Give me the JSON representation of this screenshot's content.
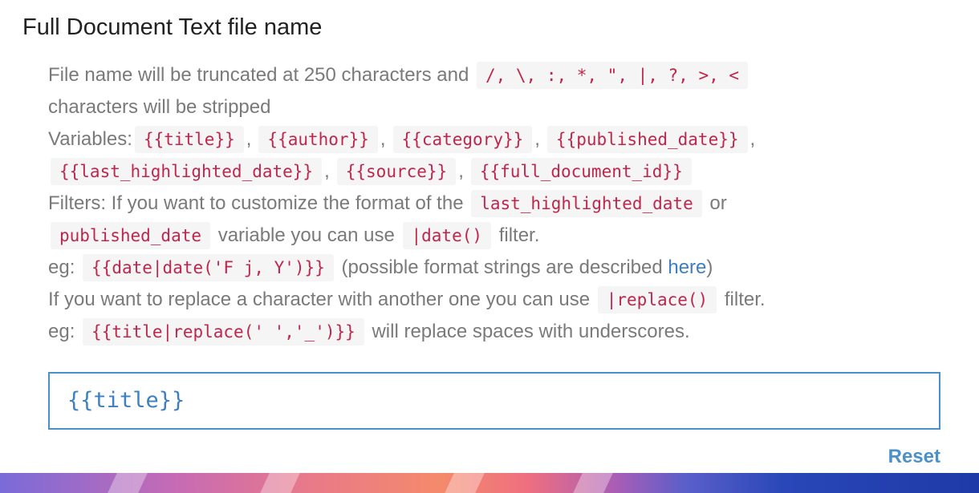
{
  "section": {
    "title": "Full Document Text file name"
  },
  "help": {
    "line1_text": "File name will be truncated at 250 characters and",
    "line1_code": "/, \\, :, *, \", |, ?, >, <",
    "line2_text": "characters will be stripped",
    "variables_label": "Variables:",
    "variables": [
      "{{title}}",
      "{{author}}",
      "{{category}}",
      "{{published_date}}",
      "{{last_highlighted_date}}",
      "{{source}}",
      "{{full_document_id}}"
    ],
    "separator": ",",
    "filters_text_1": "Filters: If you want to customize the format of the",
    "filters_code_1": "last_highlighted_date",
    "filters_or": "or",
    "filters_code_2": "published_date",
    "filters_text_2": "variable you can use",
    "filters_code_3": "|date()",
    "filters_text_3": "filter.",
    "eg_label": "eg:",
    "eg1_code": "{{date|date('F j, Y')}}",
    "eg1_text_pre": "(possible format strings are described",
    "eg1_link": "here",
    "eg1_text_post": ")",
    "replace_text_1": "If you want to replace a character with another one you can use",
    "replace_code": "|replace()",
    "replace_text_2": "filter.",
    "eg2_code": "{{title|replace(' ','_')}}",
    "eg2_text": "will replace spaces with underscores."
  },
  "input": {
    "value": "{{title}}"
  },
  "actions": {
    "reset_label": "Reset"
  },
  "colors": {
    "accent": "#4a90c9",
    "code_text": "#c0264c",
    "help_text": "#7a7a7a"
  }
}
